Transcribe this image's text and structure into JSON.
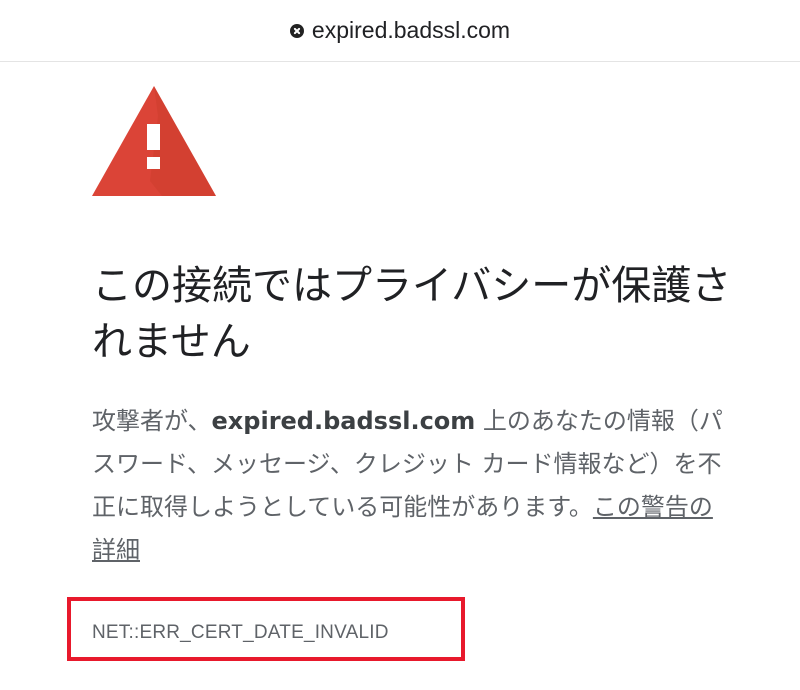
{
  "address_bar": {
    "status_icon": "error-x-icon",
    "url": "expired.badssl.com"
  },
  "interstitial": {
    "warning_icon": "warning-triangle-icon",
    "warning_color": "#db4437",
    "headline": "この接続ではプライバシーが保護されません",
    "body_prefix": "攻撃者が、",
    "host": "expired.badssl.com",
    "body_suffix": " 上のあなたの情報（パスワード、メッセージ、クレジット カード情報など）を不正に取得しようとしている可能性があります。",
    "learn_more_link": "この警告の詳細",
    "error_code": "NET::ERR_CERT_DATE_INVALID",
    "highlight_color": "#e8192c"
  }
}
